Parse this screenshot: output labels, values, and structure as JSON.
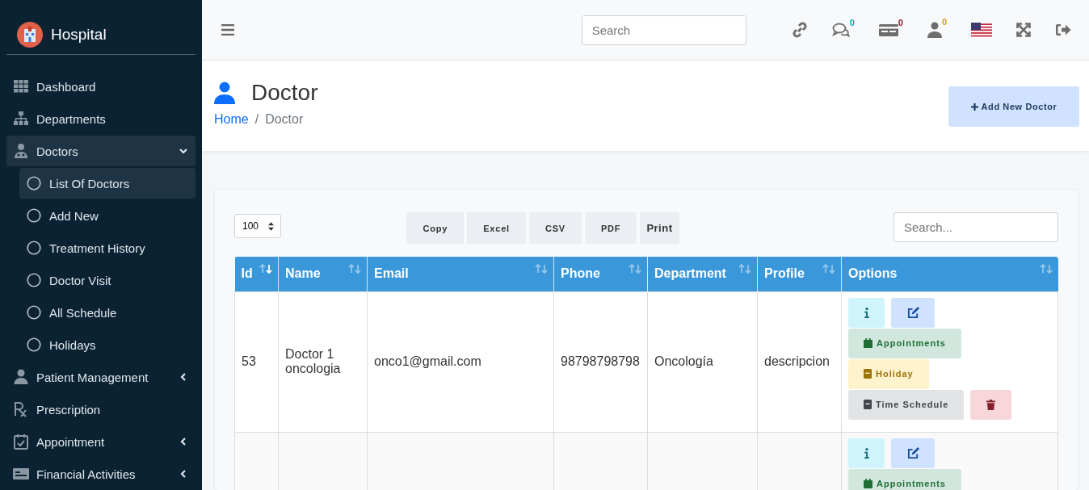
{
  "sidebar": {
    "brand": "Hospital",
    "items": [
      {
        "label": "Dashboard"
      },
      {
        "label": "Departments"
      },
      {
        "label": "Doctors",
        "expanded": true,
        "children": [
          {
            "label": "List Of Doctors",
            "selected": true
          },
          {
            "label": "Add New",
            "selected": false
          },
          {
            "label": "Treatment History",
            "selected": false
          },
          {
            "label": "Doctor Visit",
            "selected": false
          },
          {
            "label": "All Schedule",
            "selected": false
          },
          {
            "label": "Holidays",
            "selected": false
          }
        ]
      },
      {
        "label": "Patient Management",
        "expanded": false
      },
      {
        "label": "Prescription"
      },
      {
        "label": "Appointment",
        "expanded": false
      },
      {
        "label": "Financial Activities",
        "expanded": false
      }
    ]
  },
  "topbar": {
    "search": {
      "placeholder": "Search"
    },
    "badges": [
      {
        "count": "0",
        "color": "#17a2b8"
      },
      {
        "count": "0",
        "color": "#8b1a2b"
      },
      {
        "count": "0",
        "color": "#d4a20f"
      }
    ]
  },
  "page": {
    "title": "Doctor",
    "breadcrumb": [
      "Home",
      "Doctor"
    ],
    "breadcrumb_separator": "/",
    "add_button": "Add New Doctor"
  },
  "table_controls": {
    "page_length": "100",
    "export_buttons": [
      "Copy",
      "Excel",
      "CSV",
      "PDF",
      "Print"
    ],
    "search": {
      "placeholder": "Search..."
    }
  },
  "table": {
    "columns": [
      {
        "label": "Id",
        "sorted": true
      },
      {
        "label": "Name",
        "sorted": false
      },
      {
        "label": "Email",
        "sorted": false
      },
      {
        "label": "Phone",
        "sorted": false
      },
      {
        "label": "Department",
        "sorted": false
      },
      {
        "label": "Profile",
        "sorted": false
      },
      {
        "label": "Options",
        "sorted": false
      }
    ],
    "rows": [
      {
        "cells": [
          "53",
          "Doctor 1 oncologia",
          "onco1@gmail.com",
          "98798798798",
          "Oncología",
          "descripcion"
        ],
        "actions": [
          {
            "kind": "info"
          },
          {
            "kind": "edit"
          },
          {
            "kind": "appointments",
            "label": "Appointments"
          },
          {
            "kind": "holiday",
            "label": "Holiday"
          },
          {
            "kind": "schedule",
            "label": "Time Schedule"
          },
          {
            "kind": "delete"
          }
        ]
      },
      {
        "cells": [],
        "actions": [
          {
            "kind": "info"
          },
          {
            "kind": "edit"
          },
          {
            "kind": "appointments",
            "label": "Appointments"
          }
        ]
      }
    ]
  }
}
